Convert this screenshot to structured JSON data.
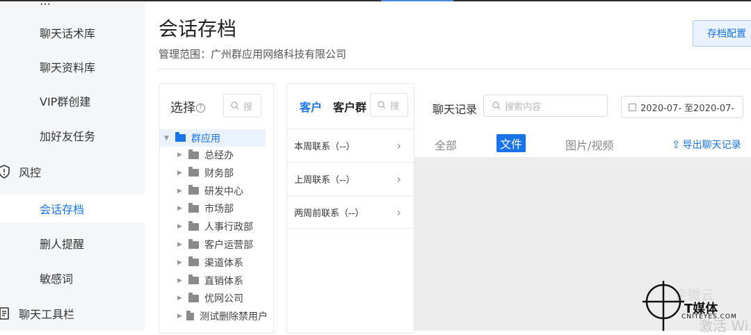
{
  "sidebar": {
    "cut_label": "…",
    "items": [
      {
        "label": "聊天话术库"
      },
      {
        "label": "聊天资料库"
      },
      {
        "label": "VIP群创建"
      },
      {
        "label": "加好友任务"
      }
    ],
    "risk_group": "风控",
    "risk_items": [
      {
        "label": "会话存档"
      },
      {
        "label": "删人提醒"
      },
      {
        "label": "敏感词"
      }
    ],
    "toolbar_group": "聊天工具栏"
  },
  "header": {
    "title": "会话存档",
    "scope": "管理范围：广州群应用网络科技有限公司",
    "config_button": "存档配置"
  },
  "tree": {
    "title": "选择",
    "help": "?",
    "search_placeholder": "搜",
    "root": "群应用",
    "nodes": [
      "总经办",
      "财务部",
      "研发中心",
      "市场部",
      "人事行政部",
      "客户运营部",
      "渠道体系",
      "直销体系",
      "优网公司",
      "测试删除禁用户"
    ]
  },
  "contacts": {
    "tabs": [
      "客户",
      "客户群"
    ],
    "search_placeholder": "搜",
    "rows": [
      "本周联系（--）",
      "上周联系（--）",
      "两周前联系（--）"
    ]
  },
  "records": {
    "title": "聊天记录",
    "search_placeholder": "搜索内容",
    "date_range": "2020-07- 至2020-07-",
    "tabs": [
      "全部",
      "文件",
      "图片/视频"
    ],
    "export": "导出聊天记录"
  },
  "watermark": {
    "top": "企微云",
    "logo": "T媒体",
    "logo_sub": "CNITEYES.COM",
    "bottom": "激活 Wi"
  }
}
